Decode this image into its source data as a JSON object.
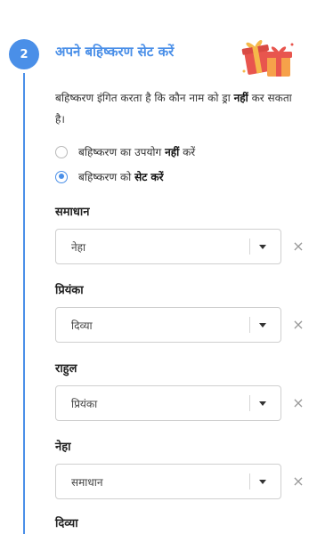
{
  "step": {
    "number": "2",
    "title": "अपने बहिष्करण सेट करें"
  },
  "description": {
    "text_before": "बहिष्करण इंगित करता है कि कौन नाम को ड्रा ",
    "bold": "नहीं",
    "text_after": " कर सकता है।"
  },
  "options": [
    {
      "before": "बहिष्करण का उपयोग ",
      "bold": "नहीं",
      "after": " करें",
      "selected": false
    },
    {
      "before": "बहिष्करण को ",
      "bold": "सेट करें",
      "after": "",
      "selected": true
    }
  ],
  "exclusions": [
    {
      "name": "समाधान",
      "selected": "नेहा",
      "clear": "×"
    },
    {
      "name": "प्रियंका",
      "selected": "दिव्या",
      "clear": "×"
    },
    {
      "name": "राहुल",
      "selected": "प्रियंका",
      "clear": "×"
    },
    {
      "name": "नेहा",
      "selected": "समाधान",
      "clear": "×"
    },
    {
      "name": "दिव्या"
    }
  ],
  "colors": {
    "accent": "#4a8fe8",
    "gift_red": "#e8554e",
    "gift_gold": "#f5b84a"
  },
  "icons": {
    "gift": "gift-icon",
    "caret": "chevron-down-icon",
    "clear": "close-icon"
  }
}
